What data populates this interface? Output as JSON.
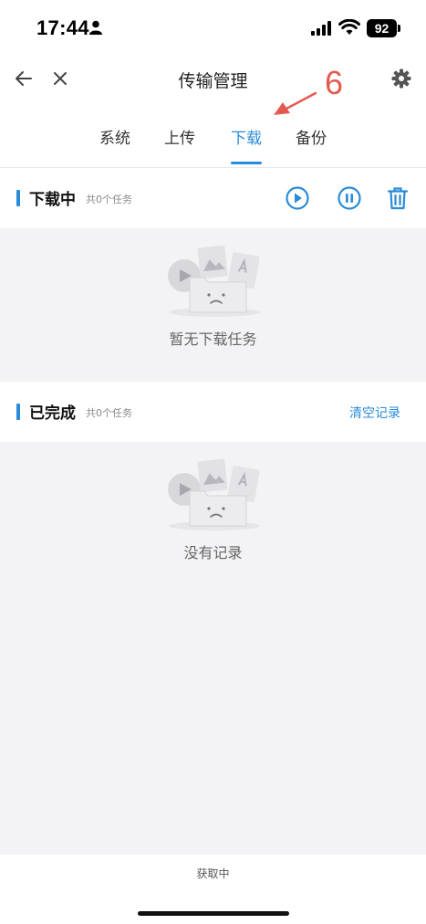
{
  "status": {
    "time": "17:44",
    "battery": "92"
  },
  "header": {
    "title": "传输管理",
    "annotation": "6"
  },
  "tabs": [
    {
      "label": "系统"
    },
    {
      "label": "上传"
    },
    {
      "label": "下载"
    },
    {
      "label": "备份"
    }
  ],
  "active_tab": "下载",
  "downloading": {
    "title": "下载中",
    "count": "共0个任务",
    "empty_text": "暂无下载任务"
  },
  "completed": {
    "title": "已完成",
    "count": "共0个任务",
    "clear_label": "清空记录",
    "empty_text": "没有记录"
  },
  "footer": {
    "loading": "获取中"
  },
  "colors": {
    "accent": "#2a8bd8",
    "annotation": "#e55a4f"
  }
}
